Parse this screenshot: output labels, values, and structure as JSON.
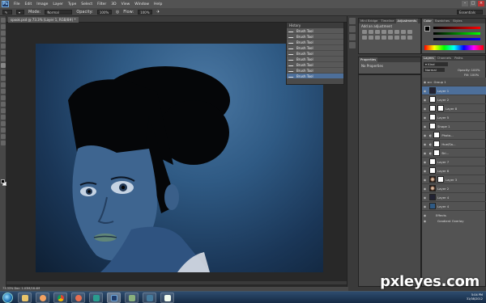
{
  "menubar": {
    "logo": "Ps",
    "items": [
      "File",
      "Edit",
      "Image",
      "Layer",
      "Type",
      "Select",
      "Filter",
      "3D",
      "View",
      "Window",
      "Help"
    ]
  },
  "options": {
    "mode_label": "Mode:",
    "mode_value": "Normal",
    "opacity_label": "Opacity:",
    "opacity_value": "100%",
    "flow_label": "Flow:",
    "flow_value": "100%",
    "workspace": "Essentials"
  },
  "document": {
    "tab_label": "spook.psd @ 73.3% (Layer 1, RGB/8#) *",
    "status": "73.33%   Doc: 1.03M/18.4M"
  },
  "history": {
    "title": "History",
    "rows": [
      "Brush Tool",
      "Brush Tool",
      "Brush Tool",
      "Brush Tool",
      "Brush Tool",
      "Brush Tool",
      "Brush Tool",
      "Brush Tool",
      "Brush Tool",
      "Brush Tool"
    ]
  },
  "adjustments": {
    "tabs": [
      "Mini Bridge",
      "Timeline",
      "Adjustments"
    ],
    "title": "Add an adjustment"
  },
  "properties": {
    "tab": "Properties",
    "body": "No Properties"
  },
  "color_panel": {
    "tabs": [
      "Color",
      "Swatches",
      "Styles"
    ]
  },
  "layers_panel": {
    "tabs": [
      "Layers",
      "Channels",
      "Paths"
    ],
    "blend": "Normal",
    "opacity_label": "Opacity:",
    "opacity_value": "100%",
    "fill_label": "Fill:",
    "fill_value": "100%",
    "rows": [
      {
        "name": "Group 1",
        "type": "group"
      },
      {
        "name": "Layer 1",
        "type": "layer",
        "sel": true
      },
      {
        "name": "Layer 2",
        "type": "layer"
      },
      {
        "name": "Layer 8",
        "type": "layer"
      },
      {
        "name": "Layer 5",
        "type": "layer"
      },
      {
        "name": "Shape 1",
        "type": "layer"
      },
      {
        "name": "Photo...",
        "type": "adj"
      },
      {
        "name": "Hue/Sa...",
        "type": "adj"
      },
      {
        "name": "Bri...",
        "type": "adj"
      },
      {
        "name": "Layer 7",
        "type": "layer"
      },
      {
        "name": "Layer 6",
        "type": "layer"
      },
      {
        "name": "Layer 3",
        "type": "layer"
      },
      {
        "name": "Layer 2",
        "type": "face"
      },
      {
        "name": "Layer 4",
        "type": "layer"
      },
      {
        "name": "Layer 4",
        "type": "layer"
      },
      {
        "name": "Effects",
        "type": "fx"
      },
      {
        "name": "Gradient Overlay",
        "type": "fx"
      }
    ]
  },
  "taskbar": {
    "time": "5:04 PM",
    "date": "31/08/2012"
  },
  "watermark": "pxleyes.com"
}
